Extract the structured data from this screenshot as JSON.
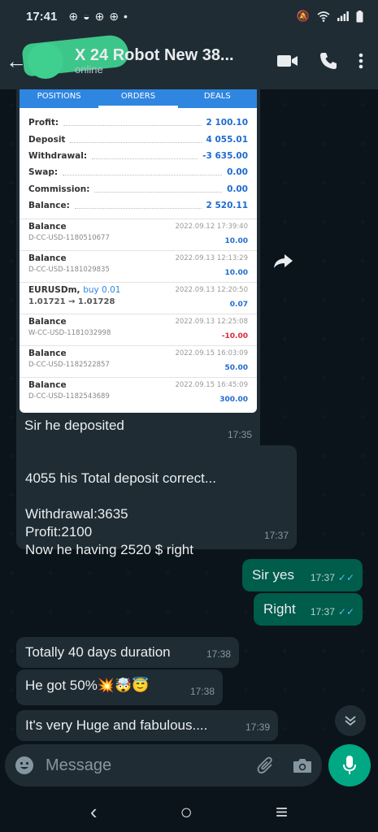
{
  "status_bar": {
    "time": "17:41",
    "notification_icons": [
      "chrome-icon",
      "messenger-icon",
      "chrome-icon",
      "chrome-icon"
    ],
    "dot": "•",
    "system_icons": [
      "mute-icon",
      "wifi-icon",
      "signal-icon",
      "battery-icon"
    ]
  },
  "header": {
    "back": "←",
    "contact_name": "X 24 Robot New 38...",
    "contact_status": "online"
  },
  "mt_card": {
    "tabs": [
      "POSITIONS",
      "ORDERS",
      "DEALS"
    ],
    "active_tab": "ORDERS",
    "summary": [
      {
        "label": "Profit:",
        "value": "2 100.10"
      },
      {
        "label": "Deposit",
        "value": "4 055.01"
      },
      {
        "label": "Withdrawal:",
        "value": "-3 635.00"
      },
      {
        "label": "Swap:",
        "value": "0.00"
      },
      {
        "label": "Commission:",
        "value": "0.00"
      },
      {
        "label": "Balance:",
        "value": "2 520.11"
      }
    ],
    "deals": [
      {
        "title": "Balance",
        "sub": "D-CC-USD-1180510677",
        "date": "2022.09.12 17:39:40",
        "amount": "10.00"
      },
      {
        "title": "Balance",
        "sub": "D-CC-USD-1181029835",
        "date": "2022.09.13 12:13:29",
        "amount": "10.00"
      },
      {
        "title": "EURUSDm,",
        "buy": "buy 0.01",
        "sub": "1.01721 → 1.01728",
        "date": "2022.09.13 12:20:50",
        "amount": "0.07"
      },
      {
        "title": "Balance",
        "sub": "W-CC-USD-1181032998",
        "date": "2022.09.13 12:25:08",
        "amount": "-10.00"
      },
      {
        "title": "Balance",
        "sub": "D-CC-USD-1182522857",
        "date": "2022.09.15 16:03:09",
        "amount": "50.00"
      },
      {
        "title": "Balance",
        "sub": "D-CC-USD-1182543689",
        "date": "2022.09.15 16:45:09",
        "amount": "300.00"
      }
    ],
    "caption": "Sir he deposited",
    "caption_time": "17:35"
  },
  "messages": [
    {
      "text": "4055 his Total deposit correct...\n\nWithdrawal:3635\nProfit:2100\nNow he having 2520 $ right",
      "time": "17:37"
    },
    {
      "text": "Sir yes",
      "time": "17:37"
    },
    {
      "text": "Right",
      "time": "17:37"
    },
    {
      "text": "Totally 40 days duration",
      "time": "17:38"
    },
    {
      "text": "He got 50%💥🤯😇",
      "time": "17:38"
    },
    {
      "text": "It's very Huge and fabulous....",
      "time": "17:39"
    }
  ],
  "input": {
    "placeholder": "Message"
  },
  "nav": {
    "back": "‹",
    "home": "○",
    "recents": "≡"
  },
  "colors": {
    "incoming": "#1f2c34",
    "outgoing": "#005c4b",
    "accent": "#00a884",
    "read_ticks": "#53bdeb"
  }
}
